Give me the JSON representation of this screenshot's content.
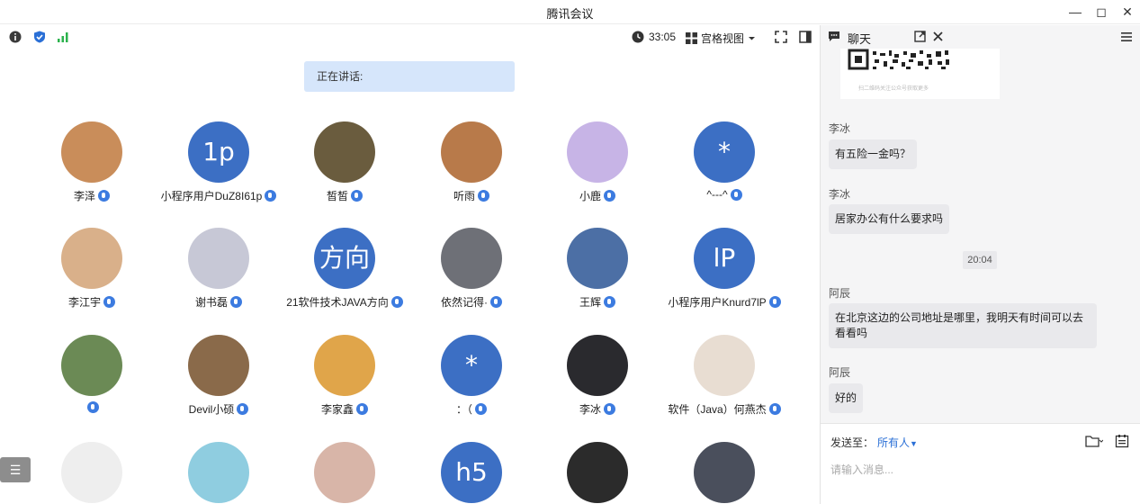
{
  "window": {
    "title": "腾讯会议"
  },
  "toolbar": {
    "timer": "33:05",
    "view_label": "宫格视图"
  },
  "stage": {
    "speaking_label": "正在讲话:",
    "participants": [
      {
        "name": "李泽",
        "initials": "",
        "color": "#c98d5a"
      },
      {
        "name": "小程序用户DuZ8I61p",
        "initials": "1p",
        "color": "#3c6fc4"
      },
      {
        "name": "皙皙",
        "initials": "",
        "color": "#6a5c3e"
      },
      {
        "name": "听雨",
        "initials": "",
        "color": "#b87a4a"
      },
      {
        "name": "小鹿",
        "initials": "",
        "color": "#c7b4e6"
      },
      {
        "name": "^---^",
        "initials": "*",
        "color": "#3c6fc4"
      },
      {
        "name": "李江宇",
        "initials": "",
        "color": "#d9b08a"
      },
      {
        "name": "谢书磊",
        "initials": "",
        "color": "#c7c8d6"
      },
      {
        "name": "21软件技术JAVA方向",
        "initials": "方向",
        "color": "#3c6fc4"
      },
      {
        "name": "依然记得·",
        "initials": "",
        "color": "#6e7077"
      },
      {
        "name": "王辉",
        "initials": "",
        "color": "#4c6fa5"
      },
      {
        "name": "小程序用户Knurd7lP",
        "initials": "lP",
        "color": "#3c6fc4"
      },
      {
        "name": "",
        "initials": "",
        "color": "#6b8a55"
      },
      {
        "name": "Devil小硕",
        "initials": "",
        "color": "#8a6a4a"
      },
      {
        "name": "李家鑫",
        "initials": "",
        "color": "#e0a54a"
      },
      {
        "name": "：（",
        "initials": "*",
        "color": "#3c6fc4"
      },
      {
        "name": "李冰",
        "initials": "",
        "color": "#2a2a2e"
      },
      {
        "name": "软件（Java）何燕杰",
        "initials": "",
        "color": "#e8ddd2"
      },
      {
        "name": "",
        "initials": "",
        "color": "#eeeeee"
      },
      {
        "name": "",
        "initials": "",
        "color": "#8fcde0"
      },
      {
        "name": "",
        "initials": "",
        "color": "#d8b5a8"
      },
      {
        "name": "",
        "initials": "h5",
        "color": "#3c6fc4"
      },
      {
        "name": "",
        "initials": "",
        "color": "#2b2b2b"
      },
      {
        "name": "",
        "initials": "",
        "color": "#4a4f5c"
      }
    ]
  },
  "chat": {
    "title": "聊天",
    "qr_caption": "扫二维码关注公众号获取更多",
    "messages": [
      {
        "sender": "李冰",
        "text": "有五险一金吗？"
      },
      {
        "sender": "李冰",
        "text": "居家办公有什么要求吗"
      },
      {
        "time": "20:04"
      },
      {
        "sender": "阿辰",
        "text": "在北京这边的公司地址是哪里，我明天有时间可以去看看吗"
      },
      {
        "sender": "阿辰",
        "text": "好的"
      }
    ],
    "send_to_label": "发送至：",
    "send_to_target": "所有人",
    "input_placeholder": "请输入消息..."
  },
  "colors": {
    "accent": "#3c6fc4",
    "link": "#2a6fd6",
    "mic": "#3c7be0"
  }
}
